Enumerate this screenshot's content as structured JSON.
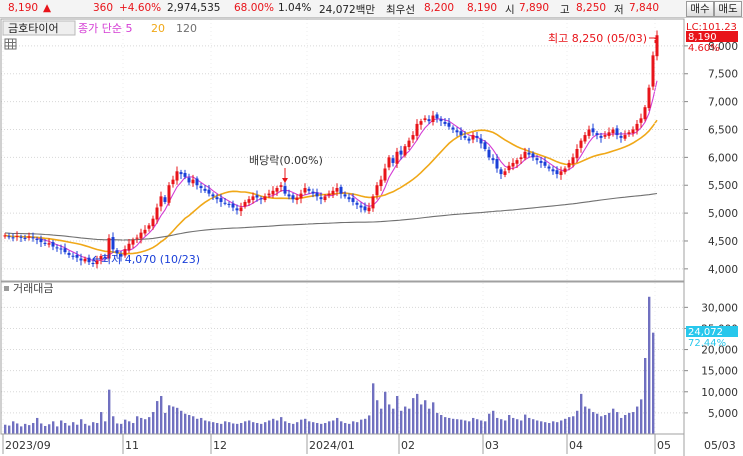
{
  "header": {
    "price": "8,190",
    "arrow": "▲",
    "change": "360",
    "change_pct": "+4.60%",
    "volume": "2,974,535",
    "turnover": "68.00%",
    "ratio": "1.04%",
    "amount": "24,072백만",
    "best_label": "최우선",
    "best_ask": "8,200",
    "best_bid": "8,190",
    "open_label": "시",
    "open": "7,890",
    "high_label": "고",
    "high": "8,250",
    "low_label": "저",
    "low": "7,840",
    "buy_label": "매수",
    "sell_label": "매도"
  },
  "legend": {
    "name": "금호타이어",
    "ma_label": "종가 단순 5",
    "ma20": "20",
    "ma120": "120",
    "volume_label": "거래대금"
  },
  "colors": {
    "up": "#e8141a",
    "down": "#1a3fd8",
    "ma5": "#d43cd4",
    "ma20": "#f0a818",
    "ma120": "#707070",
    "volume": "#7070c0",
    "badge_price": "#e8141a",
    "badge_vol": "#27c7ec"
  },
  "chart_data": {
    "type": "candlestick",
    "y_ticks": [
      "8,000",
      "7,500",
      "7,000",
      "6,500",
      "6,000",
      "5,500",
      "5,000",
      "4,500",
      "4,000"
    ],
    "y_tick_values": [
      8000,
      7500,
      7000,
      6500,
      6000,
      5500,
      5000,
      4500,
      4000
    ],
    "ylim": [
      3800,
      8500
    ],
    "x_ticks": [
      "2023/09",
      "11",
      "12",
      "2024/01",
      "02",
      "03",
      "04",
      "05"
    ],
    "x_tick_bars": [
      0,
      30,
      52,
      76,
      99,
      120,
      141,
      163
    ],
    "period_end_label": "05/03",
    "top_right_label": "LC:101.23",
    "price_badge": "8,190",
    "price_badge_pct": "4.60%",
    "high_annotation": "최고 8,250 (05/03)",
    "low_annotation": "최저 4,070 (10/23)",
    "dividend_annotation": "배당락(0.00%)",
    "dividend_bar": 70,
    "low_bar": 22,
    "high_bar": 163,
    "closes": [
      4600,
      4580,
      4560,
      4590,
      4570,
      4540,
      4580,
      4550,
      4520,
      4480,
      4450,
      4460,
      4400,
      4380,
      4350,
      4300,
      4250,
      4230,
      4200,
      4150,
      4180,
      4120,
      4100,
      4150,
      4230,
      4200,
      4550,
      4350,
      4280,
      4220,
      4350,
      4450,
      4520,
      4560,
      4650,
      4700,
      4780,
      4900,
      5100,
      5300,
      5200,
      5500,
      5600,
      5750,
      5700,
      5650,
      5550,
      5600,
      5500,
      5450,
      5400,
      5350,
      5300,
      5250,
      5200,
      5180,
      5150,
      5100,
      5050,
      5100,
      5200,
      5250,
      5300,
      5280,
      5250,
      5300,
      5350,
      5400,
      5450,
      5500,
      5350,
      5300,
      5250,
      5280,
      5350,
      5450,
      5400,
      5350,
      5300,
      5250,
      5300,
      5350,
      5400,
      5450,
      5350,
      5300,
      5250,
      5200,
      5150,
      5100,
      5050,
      5100,
      5300,
      5500,
      5600,
      5800,
      6000,
      5900,
      6100,
      6050,
      6200,
      6300,
      6400,
      6600,
      6650,
      6700,
      6650,
      6750,
      6700,
      6650,
      6600,
      6550,
      6500,
      6450,
      6400,
      6350,
      6300,
      6400,
      6350,
      6250,
      6150,
      6000,
      5950,
      5800,
      5700,
      5750,
      5850,
      5900,
      5950,
      6000,
      6100,
      6050,
      6000,
      5950,
      5900,
      5850,
      5800,
      5750,
      5700,
      5750,
      5800,
      5900,
      6000,
      6150,
      6300,
      6400,
      6500,
      6450,
      6400,
      6350,
      6400,
      6450,
      6500,
      6400,
      6350,
      6400,
      6450,
      6500,
      6600,
      6700,
      6900,
      7250,
      7830,
      8190
    ],
    "volumes": [
      2200,
      2000,
      3000,
      2500,
      1800,
      2400,
      2100,
      2600,
      3800,
      2500,
      1900,
      2300,
      3000,
      1800,
      3200,
      2600,
      2000,
      2800,
      2200,
      3500,
      2400,
      2000,
      2800,
      2600,
      5200,
      3000,
      10500,
      4200,
      2500,
      2400,
      3400,
      3000,
      2600,
      4200,
      3800,
      3500,
      4000,
      5200,
      7800,
      9000,
      5000,
      6800,
      6500,
      6200,
      5500,
      4800,
      4500,
      4200,
      3600,
      3800,
      3200,
      3000,
      2800,
      2600,
      2400,
      3000,
      2800,
      2500,
      2400,
      2600,
      3000,
      3200,
      2800,
      2600,
      2400,
      2800,
      3200,
      3600,
      3200,
      4000,
      3000,
      2600,
      2400,
      2800,
      3400,
      3600,
      3000,
      2800,
      2600,
      2400,
      2600,
      3000,
      3200,
      3800,
      3000,
      2600,
      2400,
      3000,
      2800,
      3400,
      3600,
      4400,
      12000,
      8000,
      6000,
      10000,
      7000,
      6000,
      9000,
      5500,
      6500,
      6000,
      8500,
      9500,
      7000,
      8000,
      6000,
      7500,
      5000,
      4500,
      4000,
      3800,
      3600,
      3500,
      3400,
      3200,
      3000,
      3800,
      3500,
      3200,
      3000,
      4800,
      5500,
      3800,
      3500,
      3200,
      4500,
      3800,
      3500,
      3200,
      4600,
      3800,
      3500,
      3200,
      3000,
      2800,
      2600,
      3000,
      2800,
      3200,
      3600,
      4000,
      4200,
      5500,
      9500,
      6500,
      6000,
      5200,
      4800,
      4200,
      4500,
      5000,
      6000,
      5200,
      3800,
      4500,
      5000,
      5200,
      6500,
      8200,
      18000,
      32500,
      24000
    ],
    "volume_ticks": [
      "30,000",
      "25,000",
      "20,000",
      "15,000",
      "10,000",
      "5,000"
    ],
    "volume_tick_values": [
      30000,
      25000,
      20000,
      15000,
      10000,
      5000
    ],
    "volume_ylim": [
      0,
      36000
    ],
    "volume_badge": "24,072",
    "volume_badge_pct": "72.44%"
  }
}
